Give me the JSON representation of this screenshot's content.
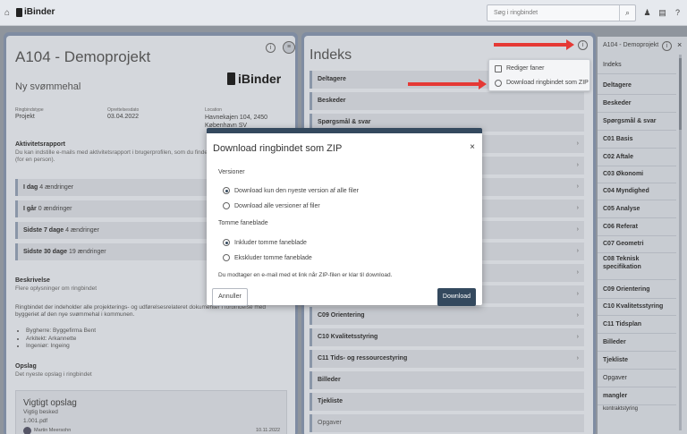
{
  "topbar": {
    "brand": "iBinder",
    "search_placeholder": "Søg i ringbindet"
  },
  "project": {
    "title": "A104 - Demoprojekt",
    "subtitle": "Ny svømmehal",
    "logo_text": "iBinder",
    "meta": [
      {
        "label": "Ringbindstype",
        "value": "Projekt"
      },
      {
        "label": "Oprettelsesdato",
        "value": "03.04.2022"
      },
      {
        "label": "Location",
        "value": "Havnekajen 104, 2450 København SV"
      }
    ],
    "activity": {
      "heading": "Aktivitetsrapport",
      "text": "Du kan indstille e-mails med aktivitetsrapport i brugerprofilen, som du finder ved at klikke på din profil (for en person).",
      "rows": [
        {
          "label": "I dag",
          "count": "4 ændringer"
        },
        {
          "label": "I går",
          "count": "0 ændringer"
        },
        {
          "label": "Sidste 7 dage",
          "count": "4 ændringer"
        },
        {
          "label": "Sidste 30 dage",
          "count": "19 ændringer"
        }
      ]
    },
    "description": {
      "heading": "Beskrivelse",
      "sub": "Flere oplysninger om ringbindet",
      "text": "Ringbindet der indeholder alle projekterings- og udførelsesrelateret dokumenter i forbindelse med byggeriet af den nye svømmehal i kommunen.",
      "bullets": [
        "Bygherre: Byggefirma Bent",
        "Arkitekt: Arkannette",
        "Ingeniør: Ingeing"
      ]
    },
    "notices": {
      "heading": "Opslag",
      "sub": "Det nyeste opslag i ringbindet",
      "card_title": "Vigtigt opslag",
      "card_sub": "Vigtig besked",
      "card_file": "1.001.pdf",
      "card_author": "Martin Meersohn",
      "card_date": "10.11.2022"
    }
  },
  "index": {
    "title": "Indeks",
    "rows_top": [
      "Deltagere",
      "Beskeder",
      "Spørgsmål & svar"
    ],
    "rows_bottom": [
      "C09 Orientering",
      "C10 Kvalitetsstyring",
      "C11 Tids- og ressourcestyring",
      "Billeder",
      "Tjekliste",
      "Opgaver"
    ]
  },
  "dropdown": {
    "items": [
      "Rediger faner",
      "Download ringbindet som ZIP"
    ]
  },
  "right_panel": {
    "header": "A104 - Demoprojekt",
    "items": [
      "Indeks",
      "Deltagere",
      "Beskeder",
      "Spørgsmål & svar",
      "C01 Basis",
      "C02 Aftale",
      "C03 Økonomi",
      "C04 Myndighed",
      "C05 Analyse",
      "C06 Referat",
      "C07 Geometri",
      "C08 Teknisk specifikation",
      "C09 Orientering",
      "C10 Kvalitetsstyring",
      "C11 Tidsplan",
      "Billeder",
      "Tjekliste",
      "Opgaver",
      "mangler",
      "kontraktstyring"
    ]
  },
  "modal": {
    "title": "Download ringbindet som ZIP",
    "versions_label": "Versioner",
    "versions_options": [
      "Download kun den nyeste version af alle filer",
      "Download alle versioner af filer"
    ],
    "versions_selected": 0,
    "empty_label": "Tomme faneblade",
    "empty_options": [
      "Inkluder tomme faneblade",
      "Ekskluder tomme faneblade"
    ],
    "empty_selected": 0,
    "note": "Du modtager en e-mail med et link når ZIP-filen er klar til download.",
    "cancel": "Annuller",
    "download": "Download"
  },
  "colors": {
    "accent": "#34495e",
    "arrow": "#e53935",
    "panel_border": "#7f8ca2"
  }
}
